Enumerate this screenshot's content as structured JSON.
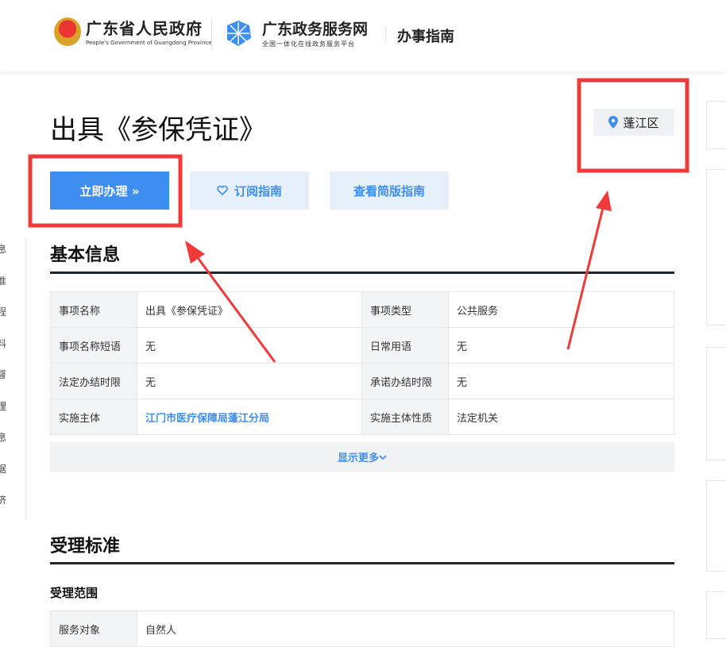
{
  "header": {
    "gov_title": "广东省人民政府",
    "gov_subtitle": "People's Government of Guangdong Province",
    "portal_title": "广东政务服务网",
    "portal_subtitle": "全国一体化在线政务服务平台",
    "section": "办事指南"
  },
  "page": {
    "title": "出具《参保凭证》",
    "region": "蓬江区"
  },
  "actions": {
    "apply": "立即办理 »",
    "subscribe": "订阅指南",
    "simple": "查看简版指南"
  },
  "sidebar": {
    "items": [
      "息",
      "准",
      "程",
      "料",
      "督",
      "理",
      "息",
      "据",
      "济"
    ]
  },
  "basic": {
    "title": "基本信息",
    "rows": [
      [
        "事项名称",
        "出具《参保凭证》",
        "事项类型",
        "公共服务"
      ],
      [
        "事项名称短语",
        "无",
        "日常用语",
        "无"
      ],
      [
        "法定办结时限",
        "无",
        "承诺办结时限",
        "无"
      ],
      [
        "实施主体",
        "江门市医疗保障局蓬江分局",
        "实施主体性质",
        "法定机关"
      ]
    ],
    "more": "显示更多"
  },
  "acceptance": {
    "title": "受理标准",
    "scope_title": "受理范围",
    "row": [
      "服务对象",
      "自然人"
    ]
  },
  "colors": {
    "accent": "#3d8ef0",
    "annotation": "#f03a3a"
  }
}
